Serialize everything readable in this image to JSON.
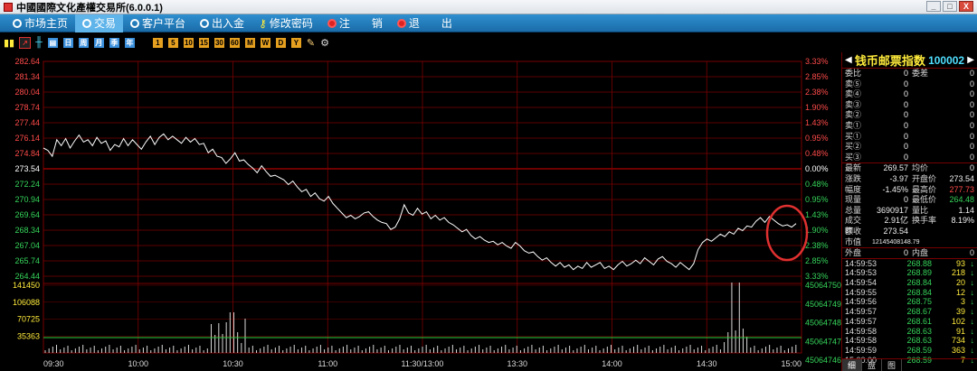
{
  "window": {
    "title": "中國國際文化產權交易所(6.0.0.1)",
    "min": "_",
    "max": "□",
    "close": "X"
  },
  "menu": {
    "items": [
      "市场主页",
      "交易",
      "客户平台",
      "出入金",
      "修改密码",
      "注",
      "销",
      "退",
      "出"
    ],
    "active_index": 1
  },
  "toolbar": {
    "buttons": [
      "日",
      "周",
      "月",
      "季",
      "年"
    ]
  },
  "stock": {
    "name": "钱币邮票指数",
    "code": "100002"
  },
  "order_book": [
    {
      "l": "委比",
      "v": "0",
      "l2": "委差",
      "v2": "0"
    },
    {
      "l": "卖⑤",
      "v": "0",
      "l2": "",
      "v2": "0"
    },
    {
      "l": "卖④",
      "v": "0",
      "l2": "",
      "v2": "0"
    },
    {
      "l": "卖③",
      "v": "0",
      "l2": "",
      "v2": "0"
    },
    {
      "l": "卖②",
      "v": "0",
      "l2": "",
      "v2": "0"
    },
    {
      "l": "卖①",
      "v": "0",
      "l2": "",
      "v2": "0"
    },
    {
      "l": "买①",
      "v": "0",
      "l2": "",
      "v2": "0"
    },
    {
      "l": "买②",
      "v": "0",
      "l2": "",
      "v2": "0"
    },
    {
      "l": "买③",
      "v": "0",
      "l2": "",
      "v2": "0"
    }
  ],
  "stats": [
    {
      "l": "最新",
      "v": "269.57",
      "vc": "green",
      "l2": "均价",
      "v2": "0",
      "v2c": "white"
    },
    {
      "l": "涨跌",
      "v": "-3.97",
      "vc": "green",
      "l2": "开盘价",
      "v2": "273.54",
      "v2c": "white"
    },
    {
      "l": "幅度",
      "v": "-1.45%",
      "vc": "green",
      "l2": "最高价",
      "v2": "277.73",
      "v2c": "red"
    },
    {
      "l": "现量",
      "v": "0",
      "vc": "white",
      "l2": "最低价",
      "v2": "264.48",
      "v2c": "green"
    },
    {
      "l": "总量",
      "v": "3690917",
      "vc": "white",
      "l2": "量比",
      "v2": "1.14",
      "v2c": "white"
    },
    {
      "l": "成交额",
      "v": "2.91亿",
      "vc": "white",
      "l2": "换手率",
      "v2": "8.19%",
      "v2c": "white"
    },
    {
      "l": "昨收",
      "v": "273.54",
      "vc": "white",
      "l2": "",
      "v2": "",
      "v2c": "white"
    },
    {
      "l": "市值",
      "v": "12145408148.79",
      "vc": "white",
      "l2": "",
      "v2": "",
      "v2c": "white"
    }
  ],
  "outer_inner": {
    "outer_label": "外盘",
    "outer": "0",
    "inner_label": "内盘",
    "inner": "0"
  },
  "ticks": [
    {
      "t": "14:59:53",
      "p": "268.88",
      "v": "93"
    },
    {
      "t": "14:59:53",
      "p": "268.89",
      "v": "218"
    },
    {
      "t": "14:59:54",
      "p": "268.84",
      "v": "20"
    },
    {
      "t": "14:59:55",
      "p": "268.84",
      "v": "12"
    },
    {
      "t": "14:59:56",
      "p": "268.75",
      "v": "3"
    },
    {
      "t": "14:59:57",
      "p": "268.67",
      "v": "39"
    },
    {
      "t": "14:59:57",
      "p": "268.61",
      "v": "102"
    },
    {
      "t": "14:59:58",
      "p": "268.63",
      "v": "91"
    },
    {
      "t": "14:59:58",
      "p": "268.63",
      "v": "734"
    },
    {
      "t": "14:59:59",
      "p": "268.59",
      "v": "363"
    },
    {
      "t": "15:00:00",
      "p": "268.59",
      "v": "7"
    }
  ],
  "panel_tabs": [
    "细",
    "盘",
    "图"
  ],
  "chart_data": {
    "type": "line",
    "price_ticks": [
      "282.64",
      "281.34",
      "280.04",
      "278.74",
      "277.44",
      "276.14",
      "274.84",
      "273.54",
      "272.24",
      "270.94",
      "269.64",
      "268.34",
      "267.04",
      "265.74",
      "264.44"
    ],
    "pct_ticks": [
      "3.33%",
      "2.85%",
      "2.38%",
      "1.90%",
      "1.43%",
      "0.95%",
      "0.48%",
      "0.00%",
      "0.48%",
      "0.95%",
      "1.43%",
      "1.90%",
      "2.38%",
      "2.85%",
      "3.33%"
    ],
    "ylim": [
      264.44,
      282.64
    ],
    "prev_close": 273.54,
    "vol_ticks_left": [
      "141450",
      "106088",
      "70725",
      "35363"
    ],
    "vol_ticks_right": [
      "45064750",
      "45064749",
      "45064748",
      "45064747",
      "45064746"
    ],
    "time_labels": [
      "09:30",
      "10:00",
      "10:30",
      "11:00",
      "11:30/13:00",
      "13:30",
      "14:00",
      "14:30",
      "15:00"
    ],
    "price_points": [
      275.3,
      275.1,
      274.6,
      276.0,
      275.5,
      276.1,
      275.3,
      275.9,
      276.4,
      275.8,
      276.0,
      275.5,
      276.2,
      275.7,
      275.9,
      275.1,
      275.6,
      275.4,
      276.1,
      275.5,
      276.0,
      275.6,
      275.2,
      275.8,
      276.3,
      275.6,
      276.2,
      276.5,
      276.0,
      276.3,
      276.0,
      275.7,
      276.2,
      275.8,
      276.1,
      275.6,
      275.7,
      274.9,
      275.2,
      274.6,
      274.5,
      274.0,
      274.4,
      274.9,
      274.2,
      274.3,
      273.9,
      273.6,
      273.2,
      273.8,
      273.3,
      272.9,
      273.0,
      272.8,
      272.6,
      272.2,
      272.5,
      272.0,
      271.6,
      271.8,
      271.2,
      271.5,
      271.0,
      270.8,
      271.2,
      270.6,
      270.2,
      269.8,
      269.4,
      269.6,
      269.3,
      269.5,
      269.8,
      269.9,
      269.5,
      269.2,
      269.0,
      268.9,
      268.4,
      268.6,
      269.3,
      270.5,
      269.8,
      269.6,
      270.2,
      269.7,
      269.9,
      269.3,
      269.6,
      269.2,
      269.4,
      269.0,
      268.8,
      268.5,
      268.2,
      268.4,
      267.9,
      267.6,
      267.8,
      267.5,
      267.3,
      267.4,
      267.1,
      267.3,
      267.0,
      266.8,
      267.3,
      267.0,
      266.6,
      266.4,
      266.5,
      266.1,
      265.8,
      266.0,
      265.6,
      265.3,
      265.6,
      265.2,
      265.4,
      265.0,
      265.3,
      265.1,
      265.6,
      265.2,
      265.4,
      265.6,
      265.1,
      265.3,
      265.0,
      265.4,
      265.7,
      265.3,
      265.5,
      265.8,
      265.5,
      266.0,
      265.7,
      265.4,
      265.9,
      266.1,
      265.7,
      265.5,
      265.2,
      265.6,
      265.3,
      265.0,
      265.5,
      266.7,
      267.3,
      267.6,
      267.4,
      267.7,
      268.0,
      267.8,
      268.2,
      268.0,
      268.5,
      268.3,
      268.7,
      268.6,
      269.1,
      269.4,
      269.0,
      269.5,
      269.2,
      268.9,
      268.7,
      268.8,
      268.6,
      268.9
    ]
  },
  "colors": {
    "accent": "#1a6ca8",
    "grid": "#7a0000",
    "price": "#ffffff",
    "up": "#ff4a4a",
    "down": "#35d35a",
    "volume": "#ffeb3b",
    "annotation": "#e03030"
  }
}
